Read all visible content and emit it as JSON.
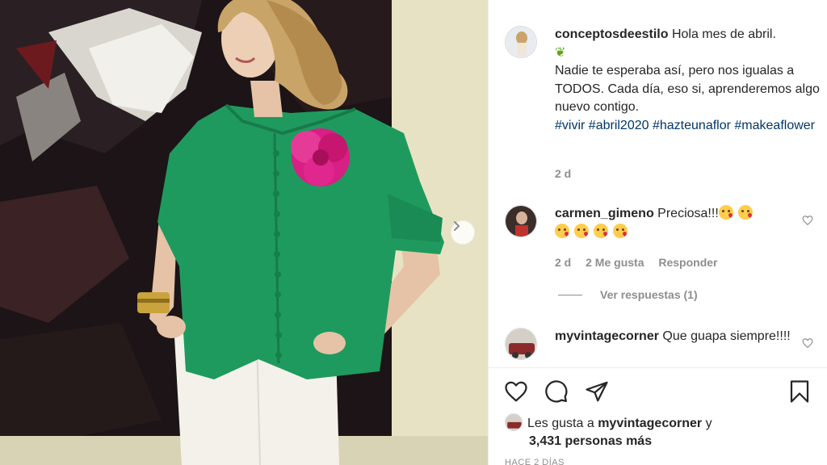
{
  "post": {
    "author": "conceptosdeestilo",
    "caption_line1": "Hola mes de abril.",
    "caption_body": "Nadie te esperaba así, pero nos igualas a TODOS. Cada día, eso si, aprenderemos algo nuevo contigo.",
    "hashtags": [
      "#vivir",
      "#abril2020",
      "#hazteunaflor",
      "#makeaflower"
    ],
    "age": "2 d"
  },
  "comments": [
    {
      "user": "carmen_gimeno",
      "text": "Preciosa!!!",
      "age": "2 d",
      "likes": "2 Me gusta",
      "reply": "Responder",
      "view_replies": "Ver respuestas (1)"
    },
    {
      "user": "myvintagecorner",
      "text": "Que guapa siempre!!!!"
    }
  ],
  "likes": {
    "prefix": "Les gusta a",
    "user": "myvintagecorner",
    "conj": "y",
    "count": "3,431 personas más"
  },
  "date": "HACE 2 DÍAS",
  "icons": {
    "like": "heart-icon",
    "comment": "comment-icon",
    "share": "share-icon",
    "save": "bookmark-icon",
    "next": "chevron-right-icon",
    "comment_like": "heart-icon"
  },
  "colors": {
    "hashtag": "#00376b",
    "muted": "#8e8e8e",
    "text": "#262626",
    "jacket": "#1f9a5e",
    "flower": "#e0278e"
  }
}
